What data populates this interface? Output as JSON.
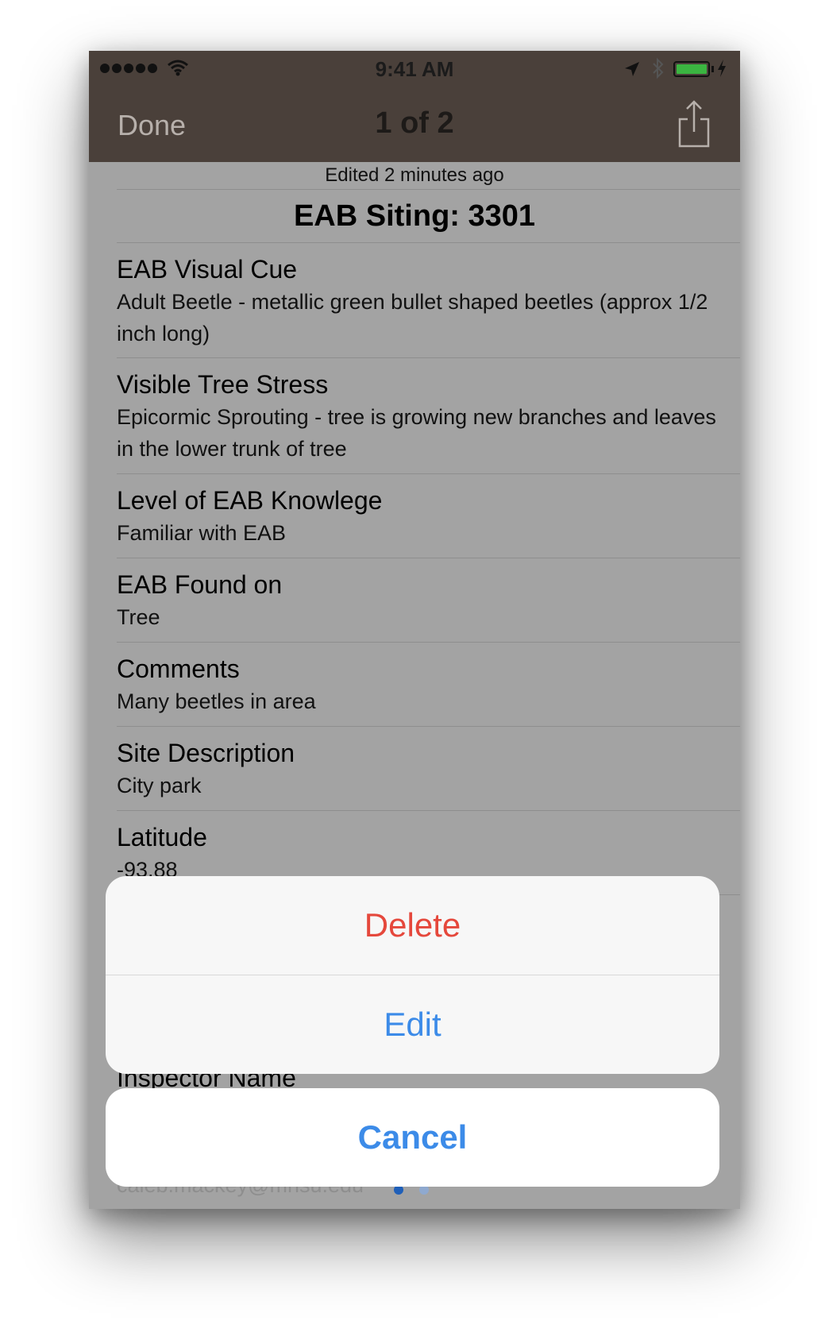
{
  "status_bar": {
    "time": "9:41 AM"
  },
  "nav": {
    "done_label": "Done",
    "title": "1 of 2"
  },
  "record": {
    "edited": "Edited 2 minutes ago",
    "title": "EAB Siting: 3301",
    "fields": [
      {
        "label": "EAB Visual Cue",
        "value": "Adult Beetle - metallic green bullet shaped beetles (approx 1/2 inch long)"
      },
      {
        "label": "Visible Tree Stress",
        "value": "Epicormic Sprouting - tree is growing new branches and leaves in the lower trunk of tree"
      },
      {
        "label": "Level of EAB Knowlege",
        "value": "Familiar with EAB"
      },
      {
        "label": "EAB Found on",
        "value": "Tree"
      },
      {
        "label": "Comments",
        "value": "Many beetles in area"
      },
      {
        "label": "Site Description",
        "value": "City park"
      },
      {
        "label": "Latitude",
        "value": "-93.88"
      }
    ],
    "partial_label": "Inspector Name",
    "partial_value": "caleb.mackey@mnsu.edu"
  },
  "action_sheet": {
    "delete_label": "Delete",
    "edit_label": "Edit",
    "cancel_label": "Cancel"
  },
  "colors": {
    "navbar": "#4a403a",
    "destructive": "#e5483c",
    "action": "#3c8be8",
    "battery": "#3bb541"
  }
}
